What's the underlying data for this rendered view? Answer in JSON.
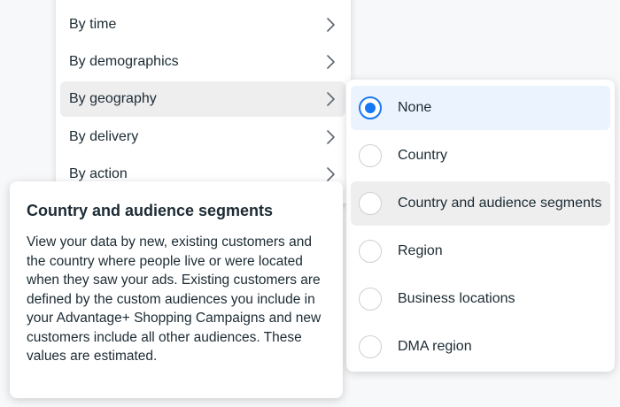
{
  "breakdown_menu": {
    "items": [
      {
        "label": "By time",
        "icon": "chevron-right-icon"
      },
      {
        "label": "By demographics",
        "icon": "chevron-right-icon"
      },
      {
        "label": "By geography",
        "icon": "chevron-right-icon",
        "active": true
      },
      {
        "label": "By delivery",
        "icon": "chevron-right-icon"
      },
      {
        "label": "By action",
        "icon": "chevron-right-icon"
      }
    ]
  },
  "geography_submenu": {
    "options": [
      {
        "label": "None",
        "selected": true
      },
      {
        "label": "Country",
        "selected": false
      },
      {
        "label": "Country and audience segments",
        "selected": false,
        "hovered": true
      },
      {
        "label": "Region",
        "selected": false
      },
      {
        "label": "Business locations",
        "selected": false
      },
      {
        "label": "DMA region",
        "selected": false
      }
    ]
  },
  "tooltip": {
    "title": "Country and audience segments",
    "body": "View your data by new, existing customers and the country where people live or were located when they saw your ads. Existing customers are defined by the custom audiences you include in your Advantage+ Shopping Campaigns and new customers include all other audiences. These values are estimated."
  },
  "colors": {
    "accent": "#1877f2",
    "selected_bg": "#ebf3fe",
    "hover_bg": "#eeeeef",
    "text": "#1c2b33"
  }
}
